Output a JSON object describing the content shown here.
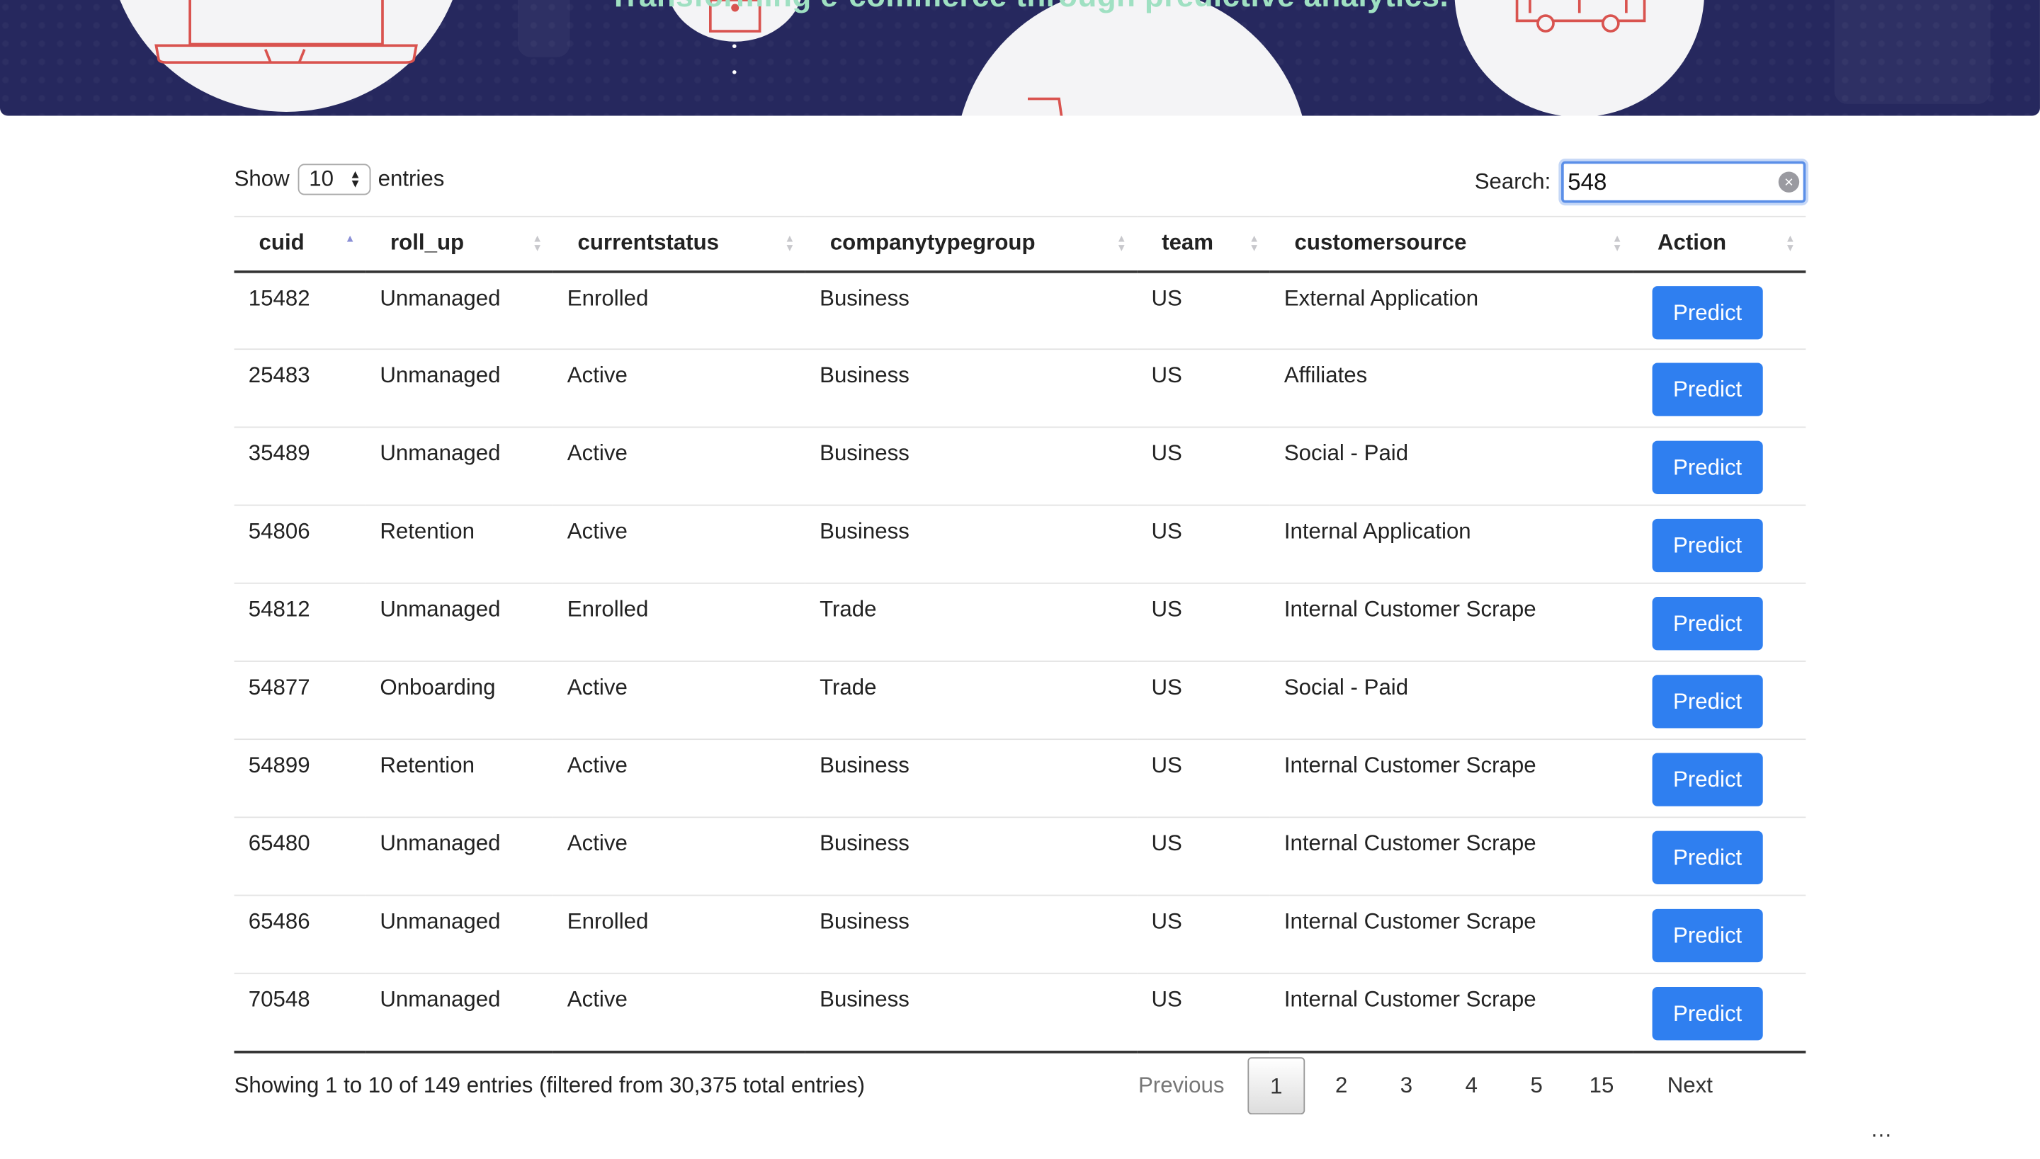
{
  "banner": {
    "tagline": "Transforming e-commerce through predictive analytics."
  },
  "controls": {
    "show_label": "Show",
    "entries_label": "entries",
    "page_length": "10",
    "search_label": "Search:",
    "search_value": "548"
  },
  "table": {
    "columns": [
      {
        "label": "cuid",
        "sort": "asc"
      },
      {
        "label": "roll_up",
        "sort": "none"
      },
      {
        "label": "currentstatus",
        "sort": "none"
      },
      {
        "label": "companytypegroup",
        "sort": "none"
      },
      {
        "label": "team",
        "sort": "none"
      },
      {
        "label": "customersource",
        "sort": "none"
      },
      {
        "label": "Action",
        "sort": "none"
      }
    ],
    "action_label": "Predict",
    "rows": [
      [
        "15482",
        "Unmanaged",
        "Enrolled",
        "Business",
        "US",
        "External Application"
      ],
      [
        "25483",
        "Unmanaged",
        "Active",
        "Business",
        "US",
        "Affiliates"
      ],
      [
        "35489",
        "Unmanaged",
        "Active",
        "Business",
        "US",
        "Social - Paid"
      ],
      [
        "54806",
        "Retention",
        "Active",
        "Business",
        "US",
        "Internal Application"
      ],
      [
        "54812",
        "Unmanaged",
        "Enrolled",
        "Trade",
        "US",
        "Internal Customer Scrape"
      ],
      [
        "54877",
        "Onboarding",
        "Active",
        "Trade",
        "US",
        "Social - Paid"
      ],
      [
        "54899",
        "Retention",
        "Active",
        "Business",
        "US",
        "Internal Customer Scrape"
      ],
      [
        "65480",
        "Unmanaged",
        "Active",
        "Business",
        "US",
        "Internal Customer Scrape"
      ],
      [
        "65486",
        "Unmanaged",
        "Enrolled",
        "Business",
        "US",
        "Internal Customer Scrape"
      ],
      [
        "70548",
        "Unmanaged",
        "Active",
        "Business",
        "US",
        "Internal Customer Scrape"
      ]
    ]
  },
  "footer": {
    "info": "Showing 1 to 10 of 149 entries (filtered from 30,375 total entries)",
    "pagination": {
      "previous": "Previous",
      "pages": [
        "1",
        "2",
        "3",
        "4",
        "5",
        "…",
        "15"
      ],
      "current": "1",
      "next": "Next"
    }
  },
  "colors": {
    "banner_bg": "#26285e",
    "accent_button": "#2f7ff0",
    "tagline": "#9fe0c2",
    "icon_stroke": "#d9534f"
  }
}
